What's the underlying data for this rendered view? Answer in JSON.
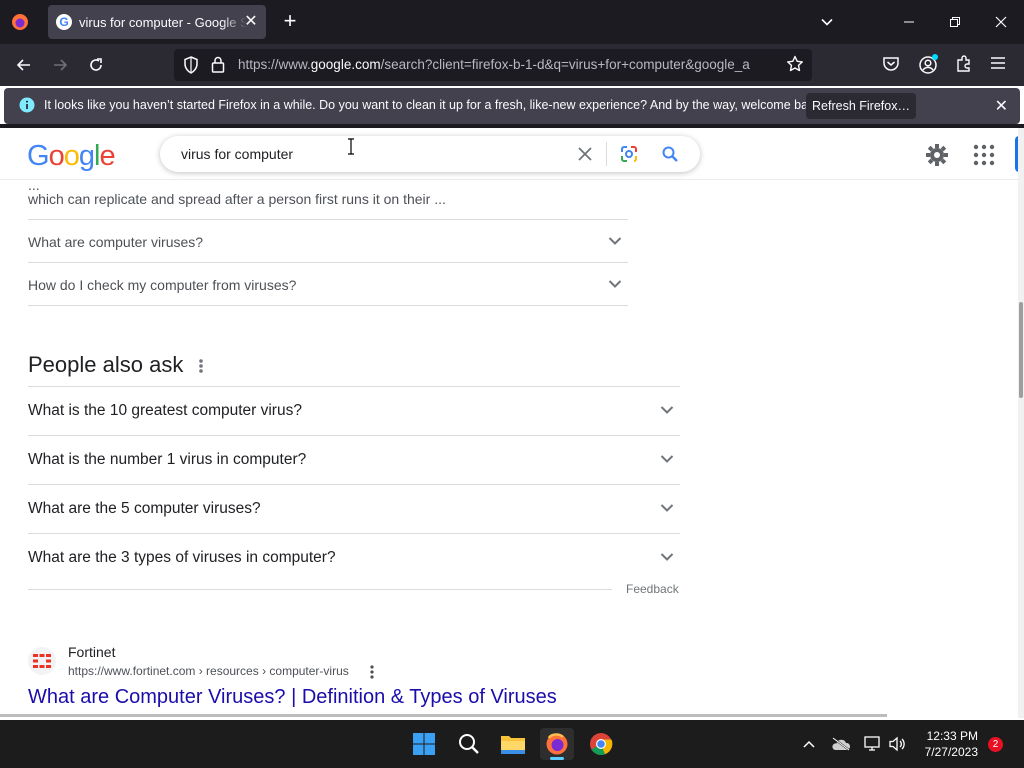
{
  "browser": {
    "tab": {
      "title": "virus for computer - Google Search"
    },
    "url": {
      "prefix": "https://www.",
      "domain": "google.com",
      "rest": "/search?client=firefox-b-1-d&q=virus+for+computer&google_a"
    },
    "notification": {
      "message": "It looks like you haven’t started Firefox in a while. Do you want to clean it up for a fresh, like-new experience? And by the way, welcome back!",
      "button": "Refresh Firefox…"
    }
  },
  "google": {
    "logo": "Google",
    "query": "virus for computer",
    "snippet": {
      "cut_line": "...",
      "line": "which can replicate and spread after a person first runs it on their ..."
    },
    "sub_questions": [
      "What are computer viruses?",
      "How do I check my computer from viruses?"
    ],
    "people_also_ask": {
      "title": "People also ask",
      "items": [
        "What is the 10 greatest computer virus?",
        "What is the number 1 virus in computer?",
        "What are the 5 computer viruses?",
        "What are the 3 types of viruses in computer?"
      ],
      "feedback": "Feedback"
    },
    "result": {
      "site": "Fortinet",
      "url": "https://www.fortinet.com › resources › computer-virus",
      "title": "What are Computer Viruses? | Definition & Types of Viruses"
    },
    "colors": {
      "link": "#1a0dab",
      "blue": "#4285f4",
      "red": "#ea4335",
      "yellow": "#fbbc05",
      "green": "#34a853"
    }
  },
  "taskbar": {
    "time": "12:33 PM",
    "date": "7/27/2023",
    "notification_count": "2",
    "apps": [
      "start-icon",
      "search-icon",
      "file-explorer-icon",
      "firefox-icon",
      "chrome-icon"
    ]
  }
}
